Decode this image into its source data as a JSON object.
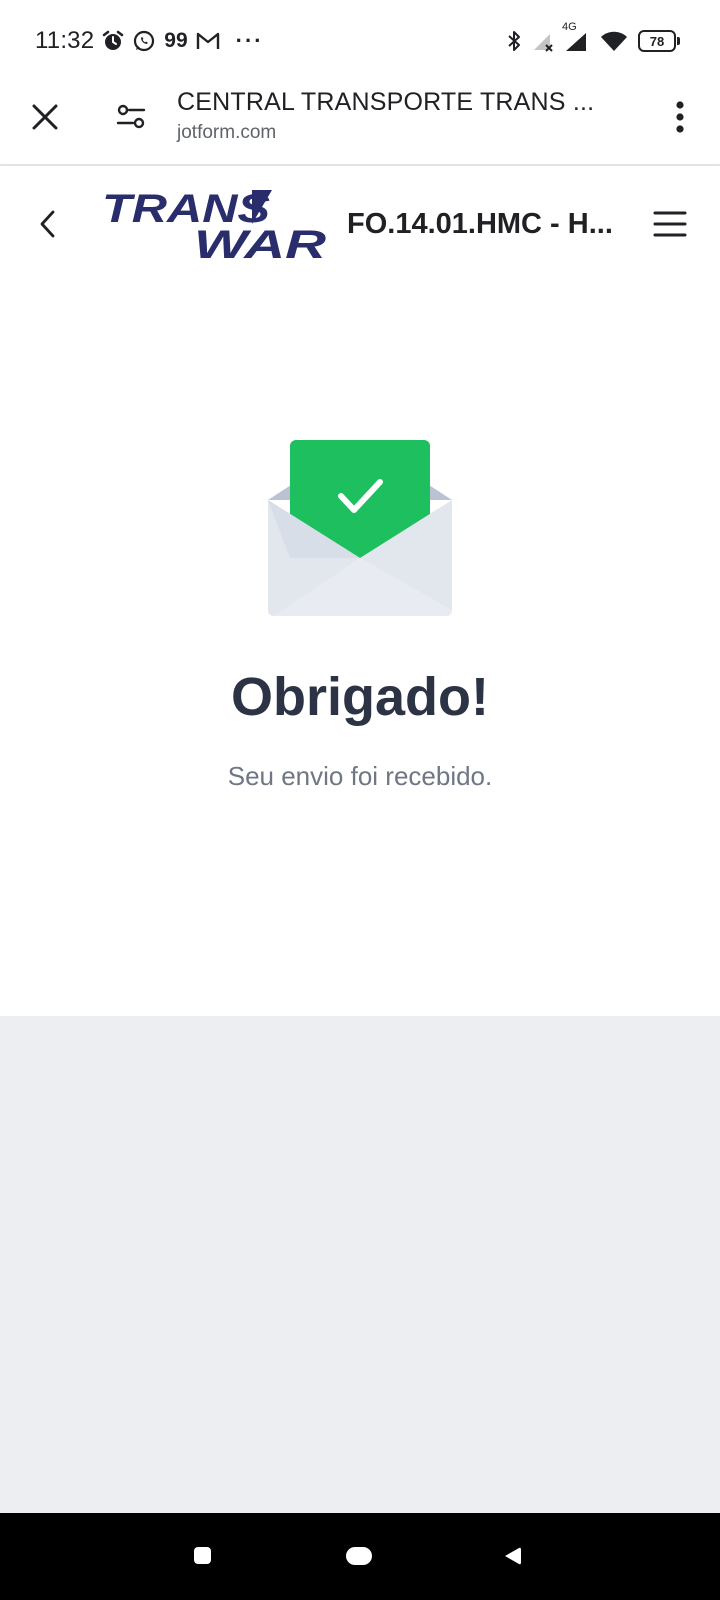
{
  "status_bar": {
    "time": "11:32",
    "notification_badge": "99",
    "overflow": "···",
    "network_type": "4G",
    "battery_level": "78",
    "icons": [
      "alarm-icon",
      "whatsapp-icon",
      "gmail-icon",
      "bluetooth-icon",
      "signal-icon",
      "wifi-icon",
      "battery-icon"
    ]
  },
  "browser": {
    "page_title": "CENTRAL TRANSPORTE TRANS ...",
    "domain": "jotform.com",
    "icons": [
      "close-icon",
      "site-settings-icon",
      "more-vert-icon"
    ]
  },
  "form": {
    "logo_line1": "TRANS",
    "logo_line2": "WAR",
    "title": "FO.14.01.HMC - H...",
    "thanks_title": "Obrigado!",
    "thanks_message": "Seu envio foi recebido.",
    "icons": [
      "back-icon",
      "envelope-check-icon",
      "hamburger-menu-icon"
    ]
  },
  "colors": {
    "logo_navy": "#2a2d6b",
    "success_green": "#1dbf5e",
    "heading": "#2c3345",
    "subtext": "#6f7684",
    "page_background": "#eceef2"
  },
  "nav_bar": {
    "icons": [
      "recent-apps-icon",
      "home-icon",
      "back-nav-icon"
    ]
  }
}
